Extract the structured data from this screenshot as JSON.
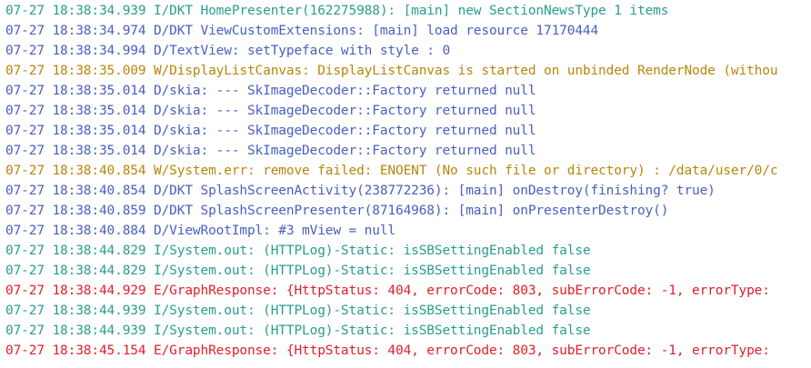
{
  "colors": {
    "I": "#2a9d8f",
    "D": "#4a5fc1",
    "W": "#b8860b",
    "E": "#e0202a"
  },
  "log": [
    {
      "level": "I",
      "text": "07-27 18:38:34.939 I/DKT HomePresenter(162275988): [main] new SectionNewsType 1 items"
    },
    {
      "level": "D",
      "text": "07-27 18:38:34.974 D/DKT ViewCustomExtensions: [main] load resource 17170444"
    },
    {
      "level": "D",
      "text": "07-27 18:38:34.994 D/TextView: setTypeface with style : 0"
    },
    {
      "level": "W",
      "text": "07-27 18:38:35.009 W/DisplayListCanvas: DisplayListCanvas is started on unbinded RenderNode (withou"
    },
    {
      "level": "D",
      "text": "07-27 18:38:35.014 D/skia: --- SkImageDecoder::Factory returned null"
    },
    {
      "level": "D",
      "text": "07-27 18:38:35.014 D/skia: --- SkImageDecoder::Factory returned null"
    },
    {
      "level": "D",
      "text": "07-27 18:38:35.014 D/skia: --- SkImageDecoder::Factory returned null"
    },
    {
      "level": "D",
      "text": "07-27 18:38:35.014 D/skia: --- SkImageDecoder::Factory returned null"
    },
    {
      "level": "W",
      "text": "07-27 18:38:40.854 W/System.err: remove failed: ENOENT (No such file or directory) : /data/user/0/c"
    },
    {
      "level": "D",
      "text": "07-27 18:38:40.854 D/DKT SplashScreenActivity(238772236): [main] onDestroy(finishing? true)"
    },
    {
      "level": "D",
      "text": "07-27 18:38:40.859 D/DKT SplashScreenPresenter(87164968): [main] onPresenterDestroy()"
    },
    {
      "level": "D",
      "text": "07-27 18:38:40.884 D/ViewRootImpl: #3 mView = null"
    },
    {
      "level": "I",
      "text": "07-27 18:38:44.829 I/System.out: (HTTPLog)-Static: isSBSettingEnabled false"
    },
    {
      "level": "I",
      "text": "07-27 18:38:44.829 I/System.out: (HTTPLog)-Static: isSBSettingEnabled false"
    },
    {
      "level": "E",
      "text": "07-27 18:38:44.929 E/GraphResponse: {HttpStatus: 404, errorCode: 803, subErrorCode: -1, errorType:"
    },
    {
      "level": "I",
      "text": "07-27 18:38:44.939 I/System.out: (HTTPLog)-Static: isSBSettingEnabled false"
    },
    {
      "level": "I",
      "text": "07-27 18:38:44.939 I/System.out: (HTTPLog)-Static: isSBSettingEnabled false"
    },
    {
      "level": "E",
      "text": "07-27 18:38:45.154 E/GraphResponse: {HttpStatus: 404, errorCode: 803, subErrorCode: -1, errorType:"
    }
  ]
}
